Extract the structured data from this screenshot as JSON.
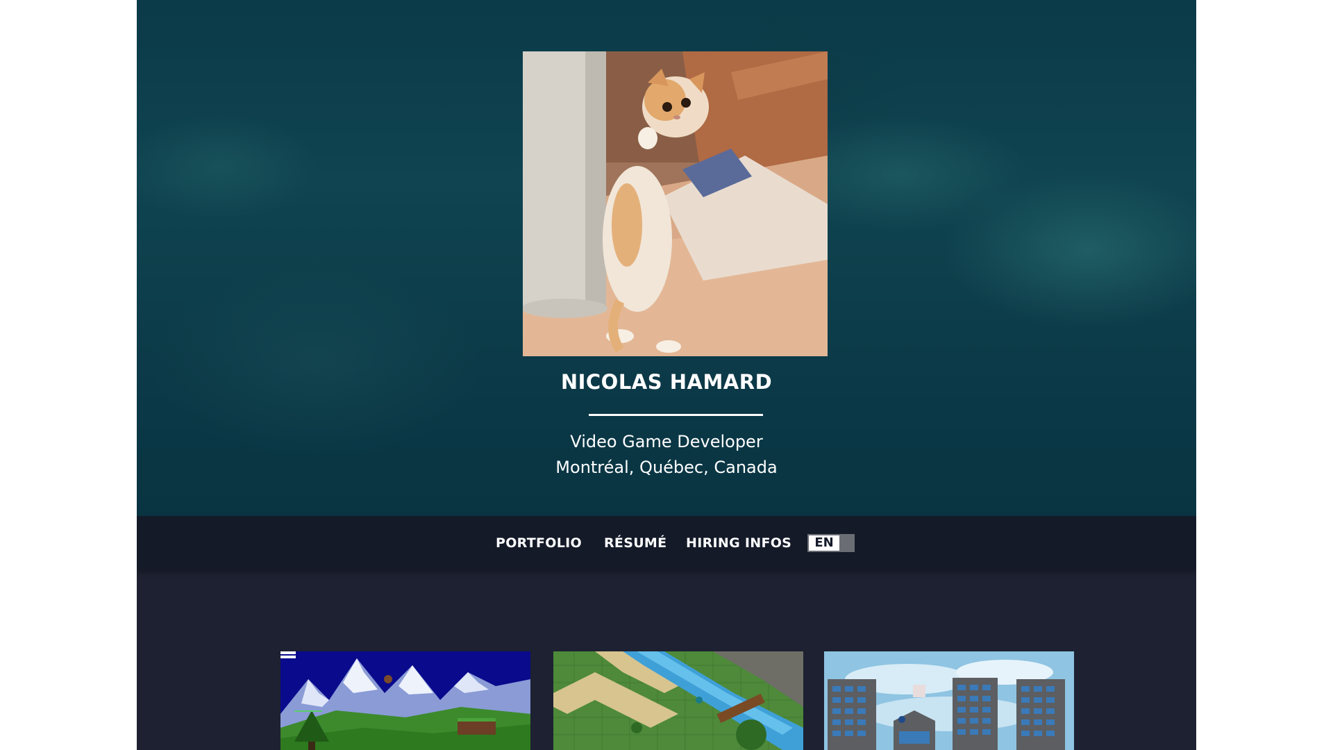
{
  "profile": {
    "name": "NICOLAS HAMARD",
    "role": "Video Game Developer",
    "location": "Montréal, Québec, Canada"
  },
  "nav": {
    "items": [
      {
        "label": "PORTFOLIO"
      },
      {
        "label": "RÉSUMÉ"
      },
      {
        "label": "HIRING INFOS"
      }
    ],
    "language": "EN"
  },
  "colors": {
    "hero": "#0f4450",
    "navbar": "#141a28",
    "content": "#1d2131",
    "text": "#ffffff"
  },
  "portfolio": {
    "thumbnails": [
      {
        "icon": "mountain-platformer-game-thumbnail"
      },
      {
        "icon": "isometric-tile-game-thumbnail"
      },
      {
        "icon": "city-buildings-game-thumbnail"
      }
    ]
  }
}
